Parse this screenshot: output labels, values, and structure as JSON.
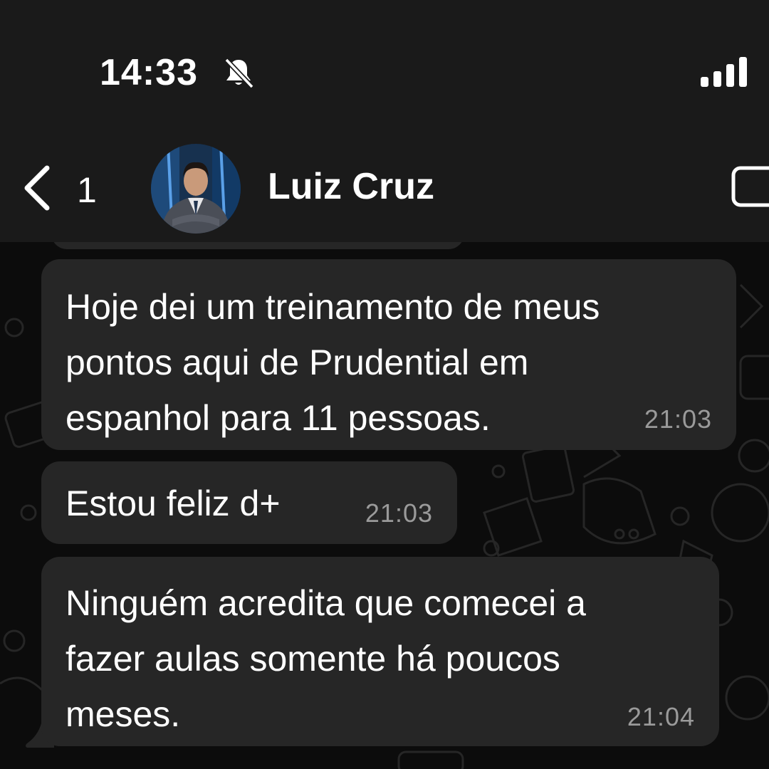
{
  "status_bar": {
    "time": "14:33",
    "mute_icon": "bell-slash-icon",
    "signal_icon": "cellular-signal-icon"
  },
  "header": {
    "back_icon": "chevron-left-icon",
    "unread_count": "1",
    "contact_name": "Luiz Cruz",
    "avatar": "contact-avatar",
    "video_icon": "video-call-icon"
  },
  "messages": [
    {
      "text": "Hoje dei um treinamento de meus\npontos aqui de Prudential em\nespanhol para 11 pessoas.",
      "time": "21:03",
      "direction": "incoming"
    },
    {
      "text": "Estou feliz d+",
      "time": "21:03",
      "direction": "incoming"
    },
    {
      "text": "Ninguém acredita que comecei a\nfazer aulas somente há poucos\nmeses.",
      "time": "21:04",
      "direction": "incoming"
    }
  ],
  "colors": {
    "header_bg": "#1a1a1a",
    "chat_bg": "#0c0c0c",
    "bubble_bg": "#262626",
    "timestamp": "#9a9a9a",
    "text": "#ffffff"
  }
}
